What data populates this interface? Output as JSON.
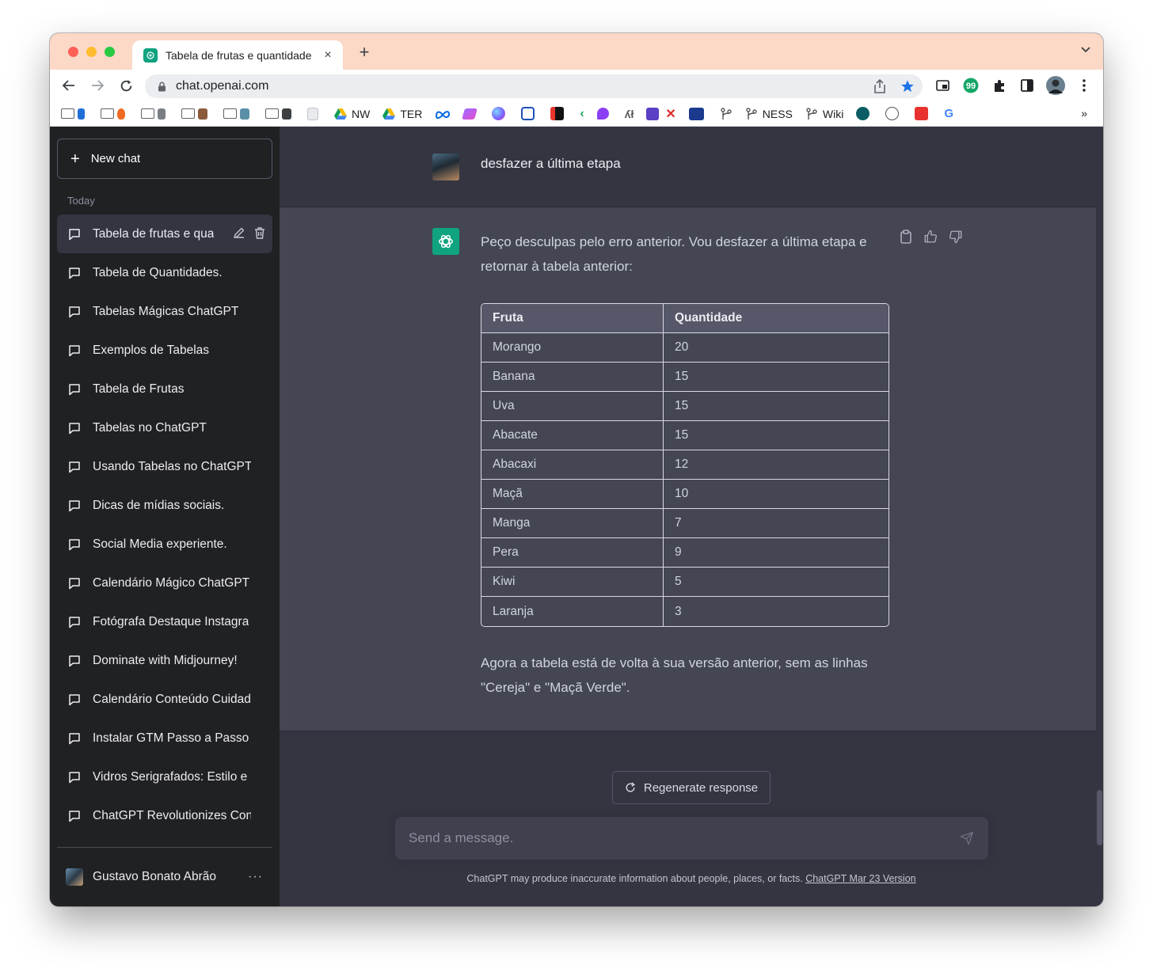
{
  "browser": {
    "tab_title": "Tabela de frutas e quantidade",
    "new_tab": "+",
    "tab_close": "×",
    "url": "chat.openai.com",
    "bookmarks": [
      {
        "label": "",
        "type": "folder"
      },
      {
        "label": "",
        "type": "folder"
      },
      {
        "label": "",
        "type": "folder"
      },
      {
        "label": "",
        "type": "folder"
      },
      {
        "label": "",
        "type": "folder"
      },
      {
        "label": "",
        "type": "folder"
      },
      {
        "label": "NW",
        "type": "drive"
      },
      {
        "label": "TER",
        "type": "drive"
      },
      {
        "label": "NESS",
        "type": "git"
      },
      {
        "label": "Wiki",
        "type": "git"
      }
    ],
    "bookmarks_more": "»",
    "colors": {
      "tabstrip": "#fcd8c7",
      "star": "#1a73e8"
    }
  },
  "sidebar": {
    "new_chat": "New chat",
    "section_today": "Today",
    "items": [
      {
        "label": "Tabela de frutas e qua",
        "active": true
      },
      {
        "label": "Tabela de Quantidades."
      },
      {
        "label": "Tabelas Mágicas ChatGPT"
      },
      {
        "label": "Exemplos de Tabelas"
      },
      {
        "label": "Tabela de Frutas"
      },
      {
        "label": "Tabelas no ChatGPT"
      },
      {
        "label": "Usando Tabelas no ChatGPT"
      },
      {
        "label": "Dicas de mídias sociais."
      },
      {
        "label": "Social Media experiente."
      },
      {
        "label": "Calendário Mágico ChatGPT"
      },
      {
        "label": "Fotógrafa Destaque Instagra"
      },
      {
        "label": "Dominate with Midjourney!"
      },
      {
        "label": "Calendário Conteúdo Cuidad"
      },
      {
        "label": "Instalar GTM Passo a Passo"
      },
      {
        "label": "Vidros Serigrafados: Estilo e"
      },
      {
        "label": "ChatGPT Revolutionizes Con"
      }
    ],
    "user_name": "Gustavo Bonato Abrão",
    "user_more": "···"
  },
  "conversation": {
    "user_message": "desfazer a última etapa",
    "assistant_intro": "Peço desculpas pelo erro anterior. Vou desfazer a última etapa e retornar à tabela anterior:",
    "table": {
      "headers": [
        "Fruta",
        "Quantidade"
      ],
      "rows": [
        [
          "Morango",
          "20"
        ],
        [
          "Banana",
          "15"
        ],
        [
          "Uva",
          "15"
        ],
        [
          "Abacate",
          "15"
        ],
        [
          "Abacaxi",
          "12"
        ],
        [
          "Maçã",
          "10"
        ],
        [
          "Manga",
          "7"
        ],
        [
          "Pera",
          "9"
        ],
        [
          "Kiwi",
          "5"
        ],
        [
          "Laranja",
          "3"
        ]
      ]
    },
    "assistant_outro": "Agora a tabela está de volta à sua versão anterior, sem as linhas \"Cereja\" e \"Maçã Verde\"."
  },
  "composer": {
    "regenerate": "Regenerate response",
    "placeholder": "Send a message.",
    "disclaimer": "ChatGPT may produce inaccurate information about people, places, or facts.",
    "version_link": "ChatGPT Mar 23 Version"
  },
  "theme": {
    "sidebar_bg": "#202123",
    "main_bg": "#343541",
    "assistant_bg": "#444654",
    "brand_green": "#10a37f"
  }
}
